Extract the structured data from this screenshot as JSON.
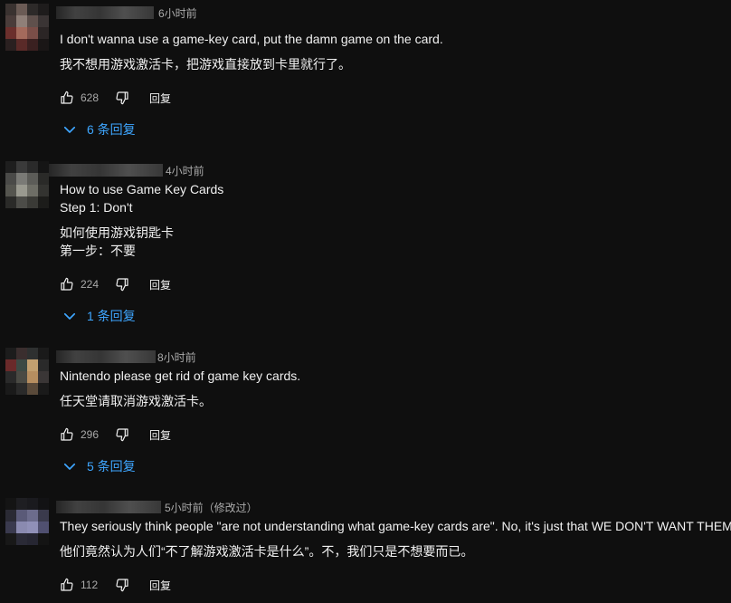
{
  "comments": [
    {
      "time": "6小时前",
      "text_lines": [
        "I don't wanna use a game-key card, put the damn game on the card."
      ],
      "translation_lines": [
        "我不想用游戏激活卡，把游戏直接放到卡里就行了。"
      ],
      "likes": "628",
      "reply_label": "回复",
      "replies_label": "6 条回复"
    },
    {
      "time": "4小时前",
      "text_lines": [
        "How to use Game Key Cards",
        "Step 1: Don't"
      ],
      "translation_lines": [
        "如何使用游戏钥匙卡",
        "第一步：不要"
      ],
      "likes": "224",
      "reply_label": "回复",
      "replies_label": "1 条回复"
    },
    {
      "time": "8小时前",
      "text_lines": [
        "Nintendo please get rid of game key cards."
      ],
      "translation_lines": [
        "任天堂请取消游戏激活卡。"
      ],
      "likes": "296",
      "reply_label": "回复",
      "replies_label": "5 条回复"
    },
    {
      "time": "5小时前（修改过）",
      "text_lines": [
        "They seriously think people \"are not understanding what game-key cards are\". No, it's just that WE DON'T WANT THEM."
      ],
      "translation_lines": [
        "他们竟然认为人们“不了解游戏激活卡是什么”。不，我们只是不想要而已。"
      ],
      "likes": "112",
      "reply_label": "回复"
    }
  ],
  "colors": {
    "background": "#0f0f0f",
    "text": "#f1f1f1",
    "meta": "#aaaaaa",
    "link": "#3ea6ff"
  },
  "icons": {
    "like": "thumb-up-icon",
    "dislike": "thumb-down-icon",
    "expand": "chevron-down-icon"
  }
}
